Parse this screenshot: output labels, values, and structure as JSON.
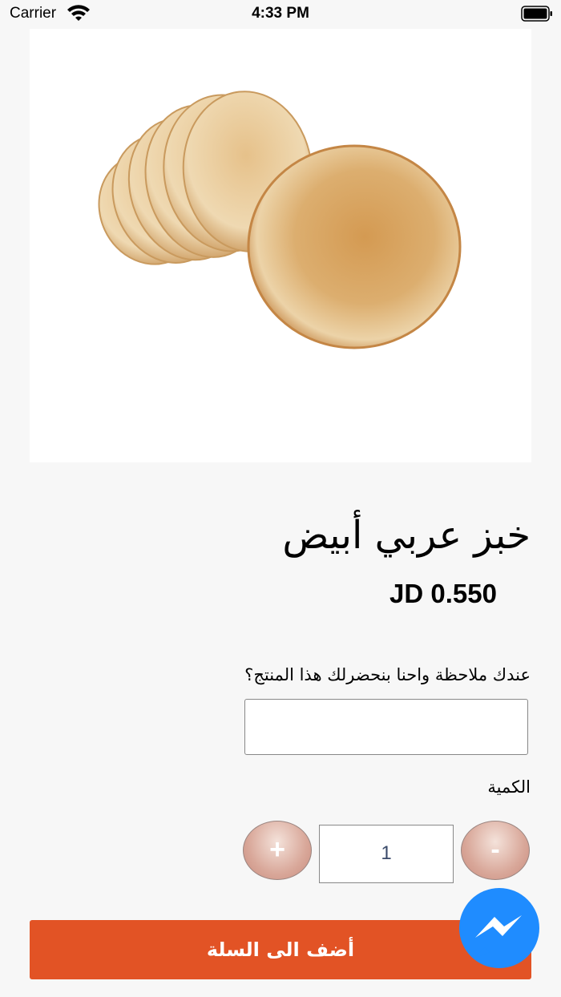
{
  "status_bar": {
    "carrier": "Carrier",
    "time": "4:33 PM"
  },
  "product": {
    "image_icon": "pita-bread-image",
    "title": "خبز عربي أبيض",
    "price": "JD 0.550"
  },
  "note": {
    "label": "عندك ملاحظة واحنا بنحضرلك هذا المنتج؟",
    "value": "",
    "placeholder": ""
  },
  "quantity": {
    "label": "الكمية",
    "plus_label": "+",
    "minus_label": "-",
    "value": "1"
  },
  "add_to_cart": {
    "label": "أضف الى السلة"
  },
  "colors": {
    "accent": "#e25325",
    "messenger": "#1f8cff",
    "background": "#f7f7f7"
  },
  "messenger_icon": "messenger-icon"
}
